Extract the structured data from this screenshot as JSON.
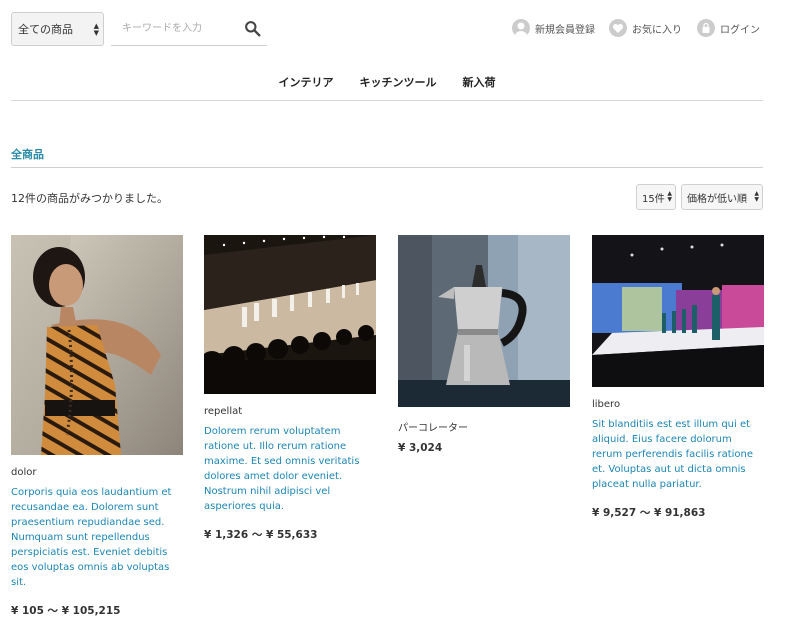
{
  "header": {
    "category_select": "全ての商品",
    "search_placeholder": "キーワードを入力",
    "links": {
      "register": "新規会員登録",
      "favorites": "お気に入り",
      "login": "ログイン"
    }
  },
  "nav": {
    "items": [
      "インテリア",
      "キッチンツール",
      "新入荷"
    ]
  },
  "breadcrumb": "全商品",
  "results": {
    "count_text": "12件の商品がみつかりました。",
    "per_page": "15件",
    "sort": "価格が低い順"
  },
  "products": [
    {
      "name": "dolor",
      "description": "Corporis quia eos laudantium et recusandae ea. Dolorem sunt praesentium repudiandae sed. Numquam sunt repellendus perspiciatis est. Eveniet debitis eos voluptas omnis ab voluptas sit.",
      "price": "¥ 105 ～ ¥ 105,215"
    },
    {
      "name": "repellat",
      "description": "Dolorem rerum voluptatem ratione ut. Illo rerum ratione maxime. Et sed omnis veritatis dolores amet dolor eveniet. Nostrum nihil adipisci vel asperiores quia.",
      "price": "¥ 1,326 ～ ¥ 55,633"
    },
    {
      "name": "パーコレーター",
      "description": "",
      "price": "¥ 3,024"
    },
    {
      "name": "libero",
      "description": "Sit blanditiis est est illum qui et aliquid. Eius facere dolorum rerum perferendis facilis ratione et. Voluptas aut ut dicta omnis placeat nulla pariatur.",
      "price": "¥ 9,527 ～ ¥ 91,863"
    }
  ],
  "colors": {
    "accent": "#2a8aa8",
    "link_text": "#1c86b4"
  }
}
